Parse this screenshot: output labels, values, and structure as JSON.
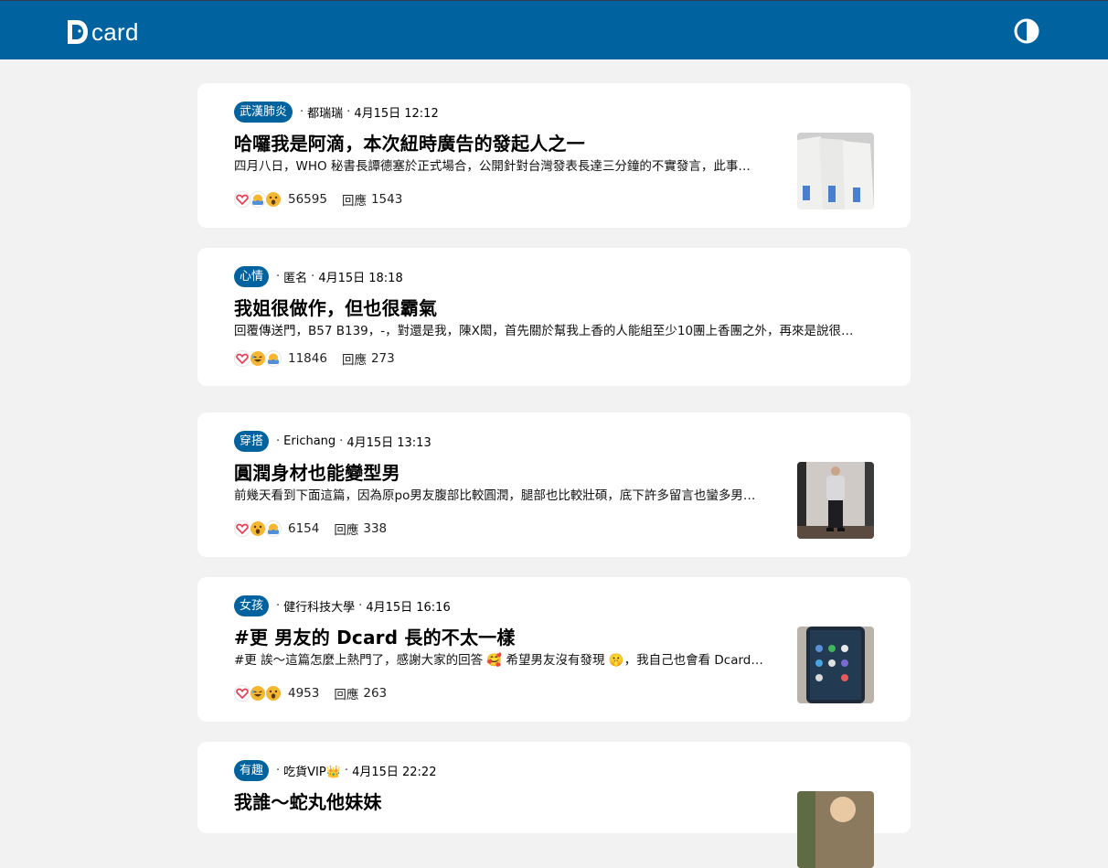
{
  "app": {
    "logo_text": "card"
  },
  "posts": [
    {
      "forum": "武漢肺炎",
      "author": "都瑞瑞",
      "time": "4月15日 12:12",
      "title": "哈囉我是阿滴，本次紐時廣告的發起人之一",
      "excerpt": "四月八日，WHO 秘書長譚德塞於正式場合，公開針對台灣發表長達三分鐘的不實發言，此事…",
      "reactions": [
        "heart-reaction-icon",
        "bow-reaction-icon",
        "wow-reaction-icon"
      ],
      "likes": "56595",
      "replies_label": "回應",
      "replies": "1543",
      "has_thumbnail": true
    },
    {
      "forum": "心情",
      "author": "匿名",
      "time": "4月15日 18:18",
      "title": "我姐很做作，但也很霸氣",
      "excerpt": "回覆傳送門，B57 B139，-，對還是我，陳X閎，首先關於幫我上香的人能組至少10團上香團之外，再來是說很…",
      "reactions": [
        "heart-reaction-icon",
        "laugh-reaction-icon",
        "bow-reaction-icon"
      ],
      "likes": "11846",
      "replies_label": "回應",
      "replies": "273",
      "has_thumbnail": false
    },
    {
      "forum": "穿搭",
      "author": "Erichang",
      "time": "4月15日 13:13",
      "title": "圓潤身材也能變型男",
      "excerpt": "前幾天看到下面這篇，因為原po男友腹部比較圓潤，腿部也比較壯碩，底下許多留言也蠻多男…",
      "reactions": [
        "heart-reaction-icon",
        "wow-reaction-icon",
        "bow-reaction-icon"
      ],
      "likes": "6154",
      "replies_label": "回應",
      "replies": "338",
      "has_thumbnail": true
    },
    {
      "forum": "女孩",
      "author": "健行科技大學",
      "time": "4月15日 16:16",
      "title": "#更 男友的 Dcard 長的不太一樣",
      "excerpt": "#更 誒～這篇怎麼上熱門了，感謝大家的回答 🥰 希望男友沒有發現 🤫，我自己也會看 Dcard…",
      "reactions": [
        "heart-reaction-icon",
        "laugh-reaction-icon",
        "wow-reaction-icon"
      ],
      "likes": "4953",
      "replies_label": "回應",
      "replies": "263",
      "has_thumbnail": true
    },
    {
      "forum": "有趣",
      "author": "吃貨VIP👑",
      "time": "4月15日 22:22",
      "title": "我誰～蛇丸他妹妹",
      "excerpt": "",
      "reactions": [],
      "likes": "",
      "replies_label": "",
      "replies": "",
      "has_thumbnail": true
    }
  ],
  "colors": {
    "brand": "#00629e",
    "background": "#f2f2f2",
    "card": "#ffffff"
  }
}
